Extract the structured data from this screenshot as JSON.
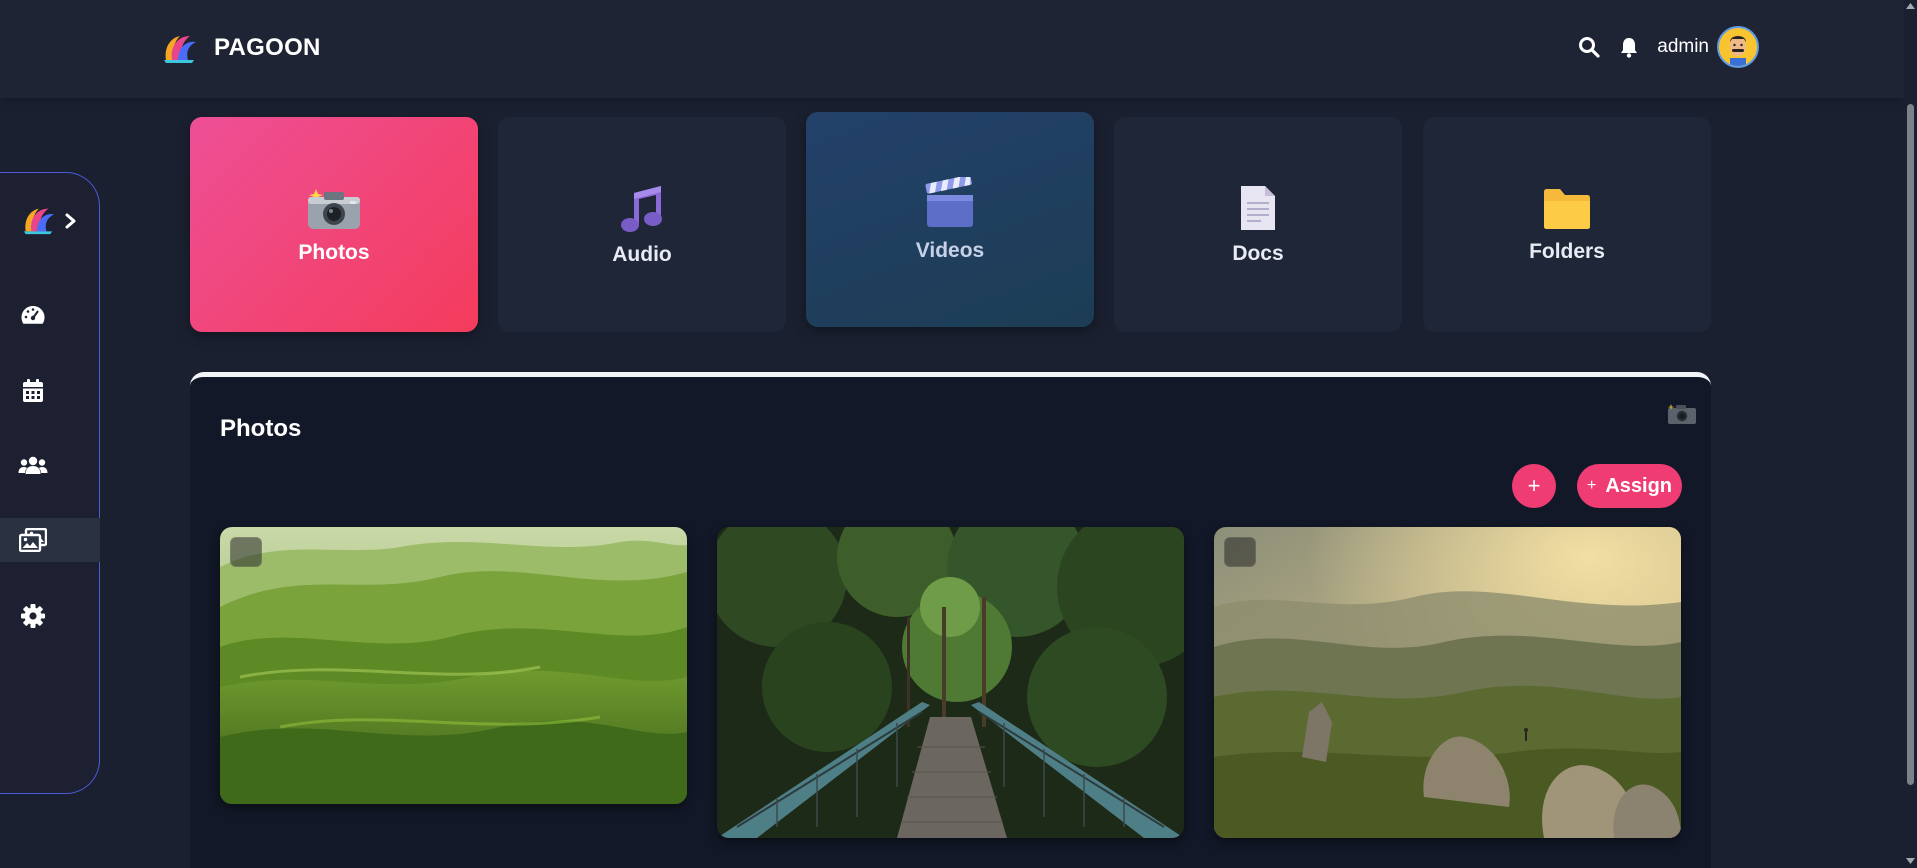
{
  "header": {
    "brand_name": "PAGOON",
    "username": "admin"
  },
  "sidebar": {
    "items": [
      {
        "icon": "dashboard-icon"
      },
      {
        "icon": "calendar-icon"
      },
      {
        "icon": "users-icon"
      },
      {
        "icon": "gallery-icon",
        "active": true
      },
      {
        "icon": "gear-icon"
      }
    ]
  },
  "categories": [
    {
      "label": "Photos",
      "icon": "camera-icon",
      "active": true
    },
    {
      "label": "Audio",
      "icon": "music-icon"
    },
    {
      "label": "Videos",
      "icon": "clapperboard-icon"
    },
    {
      "label": "Docs",
      "icon": "document-icon"
    },
    {
      "label": "Folders",
      "icon": "folder-icon"
    }
  ],
  "panel": {
    "title": "Photos",
    "add_button": "+",
    "assign_button": {
      "icon": "+",
      "label": "Assign"
    }
  },
  "photos": [
    {
      "subject": "green hills",
      "selectable": true
    },
    {
      "subject": "forest bridge",
      "selectable": false
    },
    {
      "subject": "mountain valley",
      "selectable": true
    }
  ],
  "colors": {
    "accent": "#ef3d74",
    "background": "#1b2030",
    "panel": "#121827",
    "sidebar_border": "#4a5bd8"
  }
}
